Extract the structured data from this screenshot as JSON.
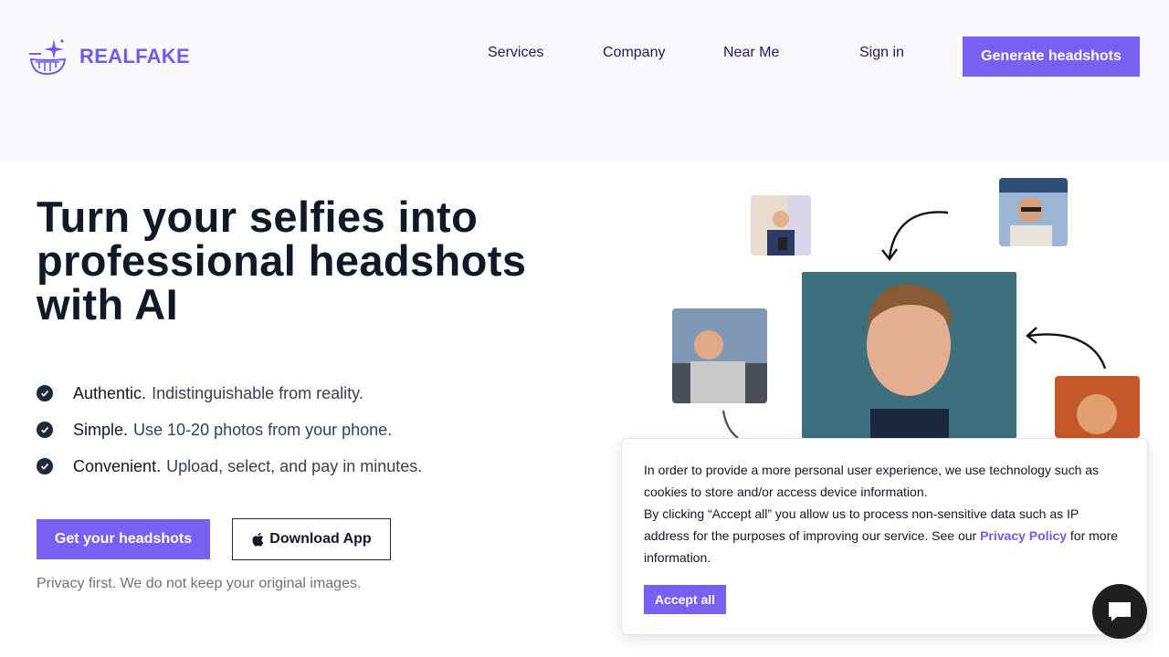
{
  "brand": {
    "name": "REALFAKE",
    "accent": "#7a60f2"
  },
  "nav": {
    "items": [
      "Services",
      "Company",
      "Near Me"
    ],
    "sign_in": "Sign in",
    "cta": "Generate headshots"
  },
  "hero": {
    "title": "Turn your selfies into professional headshots with AI",
    "features": [
      {
        "title": "Authentic.",
        "text": "Indistinguishable from reality."
      },
      {
        "title": "Simple.",
        "text": "Use 10-20 photos from your phone."
      },
      {
        "title": "Convenient.",
        "text": "Upload, select, and pay in minutes."
      }
    ],
    "primary_button": "Get your headshots",
    "secondary_button": "Download App",
    "privacy_note": "Privacy first. We do not keep your original images."
  },
  "cookie": {
    "line1": "In order to provide a more personal user experience, we use technology such as cookies to store and/or access device information.",
    "line2_pre": "By clicking “Accept all” you allow us to process non-sensitive data such as IP address for the purposes of improving our service. See our ",
    "link": "Privacy Policy",
    "line2_post": " for more information.",
    "accept": "Accept all"
  },
  "icons": {
    "logo": "sparkle-face-logo",
    "check": "check-circle-icon",
    "apple": "apple-icon",
    "chat": "chat-bubble-icon"
  }
}
